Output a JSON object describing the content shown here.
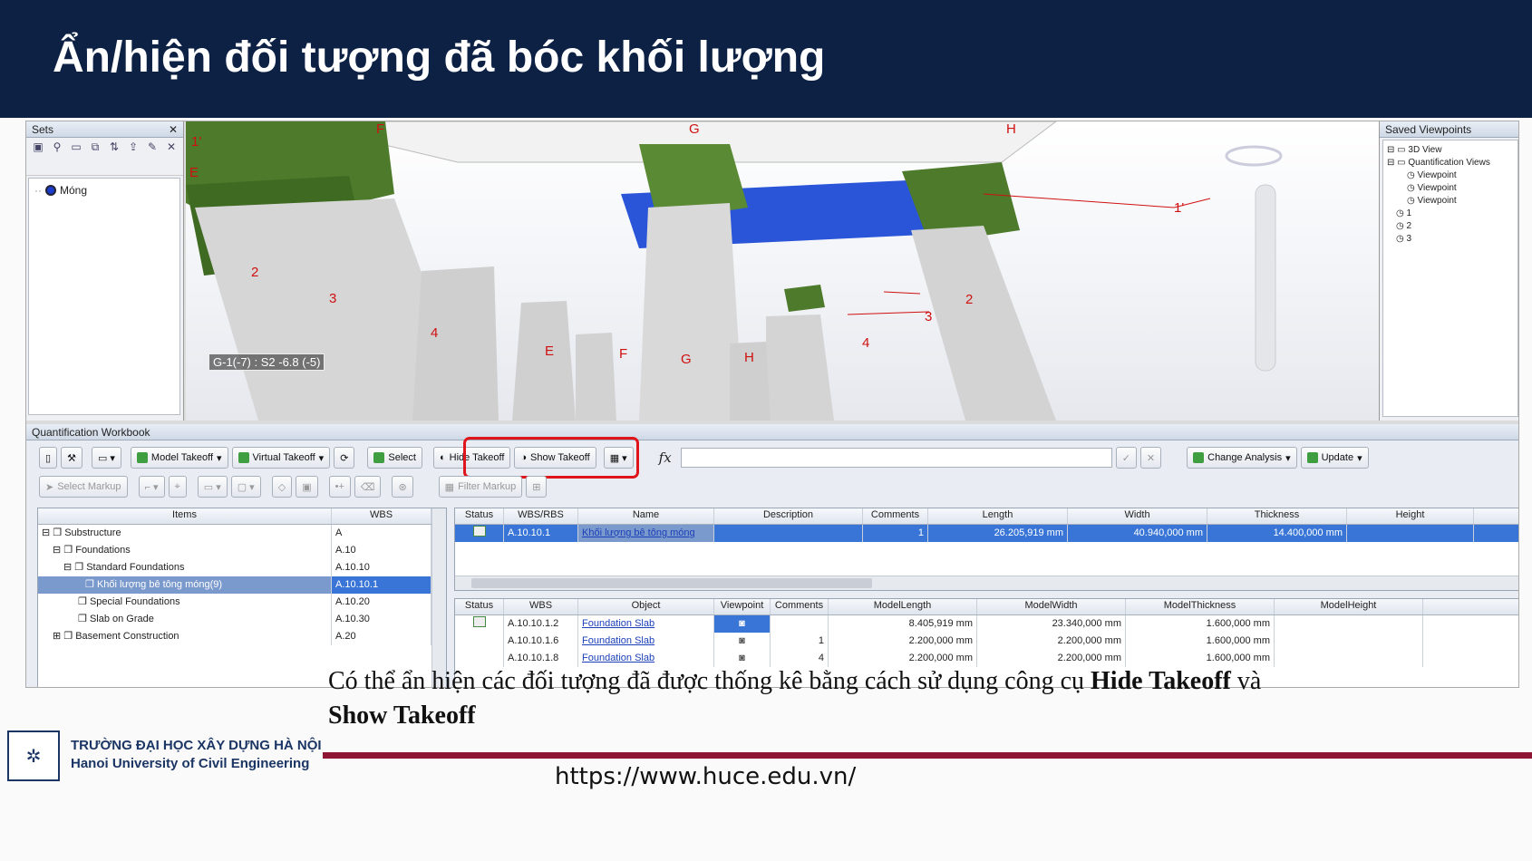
{
  "slide": {
    "title": "Ẩn/hiện đối tượng đã bóc khối lượng",
    "caption_part1": "Có thể ẩn hiện các đối tượng đã được thống kê bằng cách sử dụng công cụ ",
    "caption_bold1": "Hide Takeoff",
    "caption_part2": " và ",
    "caption_bold2": "Show Takeoff",
    "university_vi": "TRƯỜNG ĐẠI HỌC XÂY DỰNG HÀ NỘI",
    "university_en": "Hanoi University of Civil Engineering",
    "url": "https://www.huce.edu.vn/",
    "colors": {
      "header": "#0d2145",
      "accent": "#8e1534",
      "highlight": "#e0141b",
      "selection": "#3875d7"
    }
  },
  "sets_panel": {
    "title": "Sets",
    "tree_item": "Móng"
  },
  "viewport": {
    "coord_readout": "G-1(-7) : S2 -6.8 (-5)",
    "labels": [
      "1'",
      "F",
      "G",
      "H",
      "E",
      "2",
      "3",
      "4",
      "E",
      "F",
      "G",
      "H",
      "1'",
      "2",
      "3",
      "4"
    ]
  },
  "saved_viewpoints": {
    "title": "Saved Viewpoints",
    "items": [
      "3D View",
      "Quantification Views",
      "Viewpoint",
      "Viewpoint",
      "Viewpoint",
      "1",
      "2",
      "3"
    ]
  },
  "workbook": {
    "title": "Quantification Workbook",
    "toolbar": {
      "model_takeoff": "Model Takeoff",
      "virtual_takeoff": "Virtual Takeoff",
      "select": "Select",
      "hide_takeoff": "Hide Takeoff",
      "show_takeoff": "Show Takeoff",
      "fx": "fx",
      "change_analysis": "Change Analysis",
      "update": "Update",
      "select_markup": "Select Markup",
      "filter_markup": "Filter Markup"
    },
    "items_grid": {
      "headers": [
        "Items",
        "WBS"
      ],
      "rows": [
        {
          "name": "Substructure",
          "wbs": "A"
        },
        {
          "name": "Foundations",
          "wbs": "A.10"
        },
        {
          "name": "Standard Foundations",
          "wbs": "A.10.10"
        },
        {
          "name": "Khối lượng bê tông móng(9)",
          "wbs": "A.10.10.1"
        },
        {
          "name": "Special Foundations",
          "wbs": "A.10.20"
        },
        {
          "name": "Slab on Grade",
          "wbs": "A.10.30"
        },
        {
          "name": "Basement Construction",
          "wbs": "A.20"
        }
      ]
    },
    "top_grid": {
      "headers": [
        "Status",
        "WBS/RBS",
        "Name",
        "Description",
        "Comments",
        "Length",
        "Width",
        "Thickness",
        "Height"
      ],
      "row": {
        "wbs": "A.10.10.1",
        "name": "Khối lượng bê tông móng",
        "description": "",
        "comments": "1",
        "length": "26.205,919 mm",
        "width": "40.940,000 mm",
        "thickness": "14.400,000 mm"
      }
    },
    "bottom_grid": {
      "headers": [
        "Status",
        "WBS",
        "Object",
        "Viewpoint",
        "Comments",
        "ModelLength",
        "ModelWidth",
        "ModelThickness",
        "ModelHeight"
      ],
      "rows": [
        {
          "wbs": "A.10.10.1.2",
          "object": "Foundation Slab",
          "comments": "",
          "length": "8.405,919 mm",
          "width": "23.340,000 mm",
          "thickness": "1.600,000 mm"
        },
        {
          "wbs": "A.10.10.1.6",
          "object": "Foundation Slab",
          "comments": "1",
          "length": "2.200,000 mm",
          "width": "2.200,000 mm",
          "thickness": "1.600,000 mm"
        },
        {
          "wbs": "A.10.10.1.8",
          "object": "Foundation Slab",
          "comments": "4",
          "length": "2.200,000 mm",
          "width": "2.200,000 mm",
          "thickness": "1.600,000 mm"
        }
      ]
    }
  }
}
